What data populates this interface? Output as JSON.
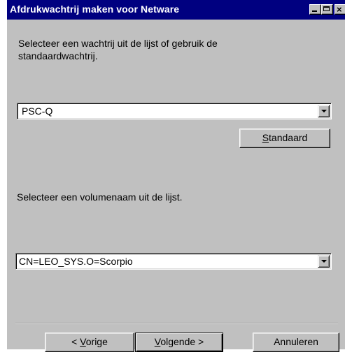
{
  "window": {
    "title": "Afdrukwachtrij maken voor Netware",
    "controls": {
      "minimize_icon": "minimize-icon",
      "maximize_icon": "maximize-icon",
      "close_icon": "close-icon",
      "close_glyph": "×"
    }
  },
  "queue_section": {
    "instruction": "Selecteer een wachtrij uit de lijst of gebruik de standaardwachtrij.",
    "instruction_line1": "Selecteer een wachtrij uit de lijst of gebruik de",
    "instruction_line2": "standaardwachtrij.",
    "selected_queue": "PSC-Q",
    "standard_button": {
      "label": "Standaard",
      "accel_char": "S",
      "rest": "tandaard"
    }
  },
  "volume_section": {
    "instruction": "Selecteer een volumenaam uit de lijst.",
    "selected_volume": "CN=LEO_SYS.O=Scorpio"
  },
  "footer": {
    "back_button": {
      "label": "< Vorige",
      "prefix": "< ",
      "accel_char": "V",
      "rest": "orige"
    },
    "next_button": {
      "label": "Volgende >",
      "accel_char": "V",
      "rest": "olgende >"
    },
    "cancel_button": {
      "label": "Annuleren"
    }
  },
  "colors": {
    "titlebar": "#000080",
    "dialog_face": "#c0c0c0",
    "title_text": "#ffffff"
  }
}
